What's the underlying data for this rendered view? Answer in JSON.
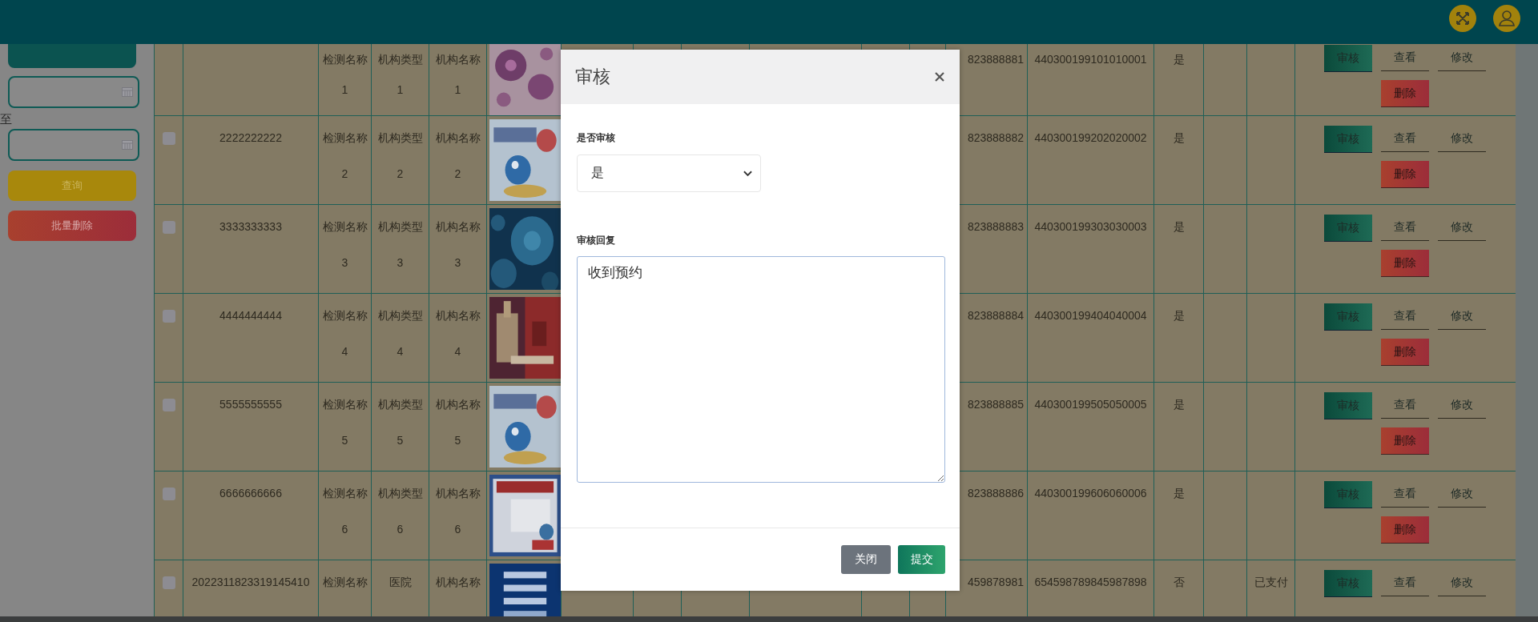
{
  "sidebar": {
    "range_separator": "至",
    "buttons": [
      {
        "label": "查询",
        "kind": "search"
      },
      {
        "label": "批量删除",
        "kind": "delete"
      }
    ]
  },
  "table": {
    "rows": [
      {
        "test_name": "检测名称1",
        "org_type": "机构类型1",
        "org_name": "机构名称1",
        "phone": "823888881",
        "id_card": "440300199101010001",
        "audited": "是",
        "actions": [
          {
            "label": "审核",
            "kind": "audit"
          },
          {
            "label": "查看",
            "kind": "view"
          },
          {
            "label": "修改",
            "kind": "edit"
          },
          {
            "label": "删除",
            "kind": "delete"
          }
        ]
      },
      {
        "checked": false,
        "id": "2222222222",
        "test_name": "检测名称2",
        "org_type": "机构类型2",
        "org_name": "机构名称2",
        "phone": "823888882",
        "id_card": "440300199202020002",
        "audited": "是",
        "actions": [
          {
            "label": "审核",
            "kind": "audit"
          },
          {
            "label": "查看",
            "kind": "view"
          },
          {
            "label": "修改",
            "kind": "edit"
          },
          {
            "label": "删除",
            "kind": "delete"
          }
        ]
      },
      {
        "checked": false,
        "id": "3333333333",
        "test_name": "检测名称3",
        "org_type": "机构类型3",
        "org_name": "机构名称3",
        "phone": "823888883",
        "id_card": "440300199303030003",
        "audited": "是",
        "actions": [
          {
            "label": "审核",
            "kind": "audit"
          },
          {
            "label": "查看",
            "kind": "view"
          },
          {
            "label": "修改",
            "kind": "edit"
          },
          {
            "label": "删除",
            "kind": "delete"
          }
        ]
      },
      {
        "checked": false,
        "id": "4444444444",
        "test_name": "检测名称4",
        "org_type": "机构类型4",
        "org_name": "机构名称4",
        "phone": "823888884",
        "id_card": "440300199404040004",
        "audited": "是",
        "actions": [
          {
            "label": "审核",
            "kind": "audit"
          },
          {
            "label": "查看",
            "kind": "view"
          },
          {
            "label": "修改",
            "kind": "edit"
          },
          {
            "label": "删除",
            "kind": "delete"
          }
        ]
      },
      {
        "checked": false,
        "id": "5555555555",
        "test_name": "检测名称5",
        "org_type": "机构类型5",
        "org_name": "机构名称5",
        "phone": "823888885",
        "id_card": "440300199505050005",
        "audited": "是",
        "actions": [
          {
            "label": "审核",
            "kind": "audit"
          },
          {
            "label": "查看",
            "kind": "view"
          },
          {
            "label": "修改",
            "kind": "edit"
          },
          {
            "label": "删除",
            "kind": "delete"
          }
        ]
      },
      {
        "checked": false,
        "id": "6666666666",
        "test_name": "检测名称6",
        "org_type": "机构类型6",
        "org_name": "机构名称6",
        "phone": "823888886",
        "id_card": "440300199606060006",
        "audited": "是",
        "actions": [
          {
            "label": "审核",
            "kind": "audit"
          },
          {
            "label": "查看",
            "kind": "view"
          },
          {
            "label": "修改",
            "kind": "edit"
          },
          {
            "label": "删除",
            "kind": "delete"
          }
        ]
      },
      {
        "checked": false,
        "id": "2022311823319145410",
        "test_name": "检测名称",
        "org_type": "医院",
        "org_name": "机构名称",
        "phone": "459878981",
        "id_card": "654598789845987898",
        "audited": "否",
        "payment": "已支付",
        "actions": [
          {
            "label": "审核",
            "kind": "audit"
          },
          {
            "label": "查看",
            "kind": "view"
          },
          {
            "label": "修改",
            "kind": "edit"
          }
        ]
      }
    ]
  },
  "modal": {
    "title": "审核",
    "fields": [
      {
        "label": "是否审核",
        "kind": "select",
        "value": "是"
      },
      {
        "label": "审核回复",
        "kind": "textarea",
        "value": "收到预约"
      }
    ],
    "buttons": [
      {
        "label": "关闭",
        "kind": "secondary"
      },
      {
        "label": "提交",
        "kind": "primary"
      }
    ]
  }
}
